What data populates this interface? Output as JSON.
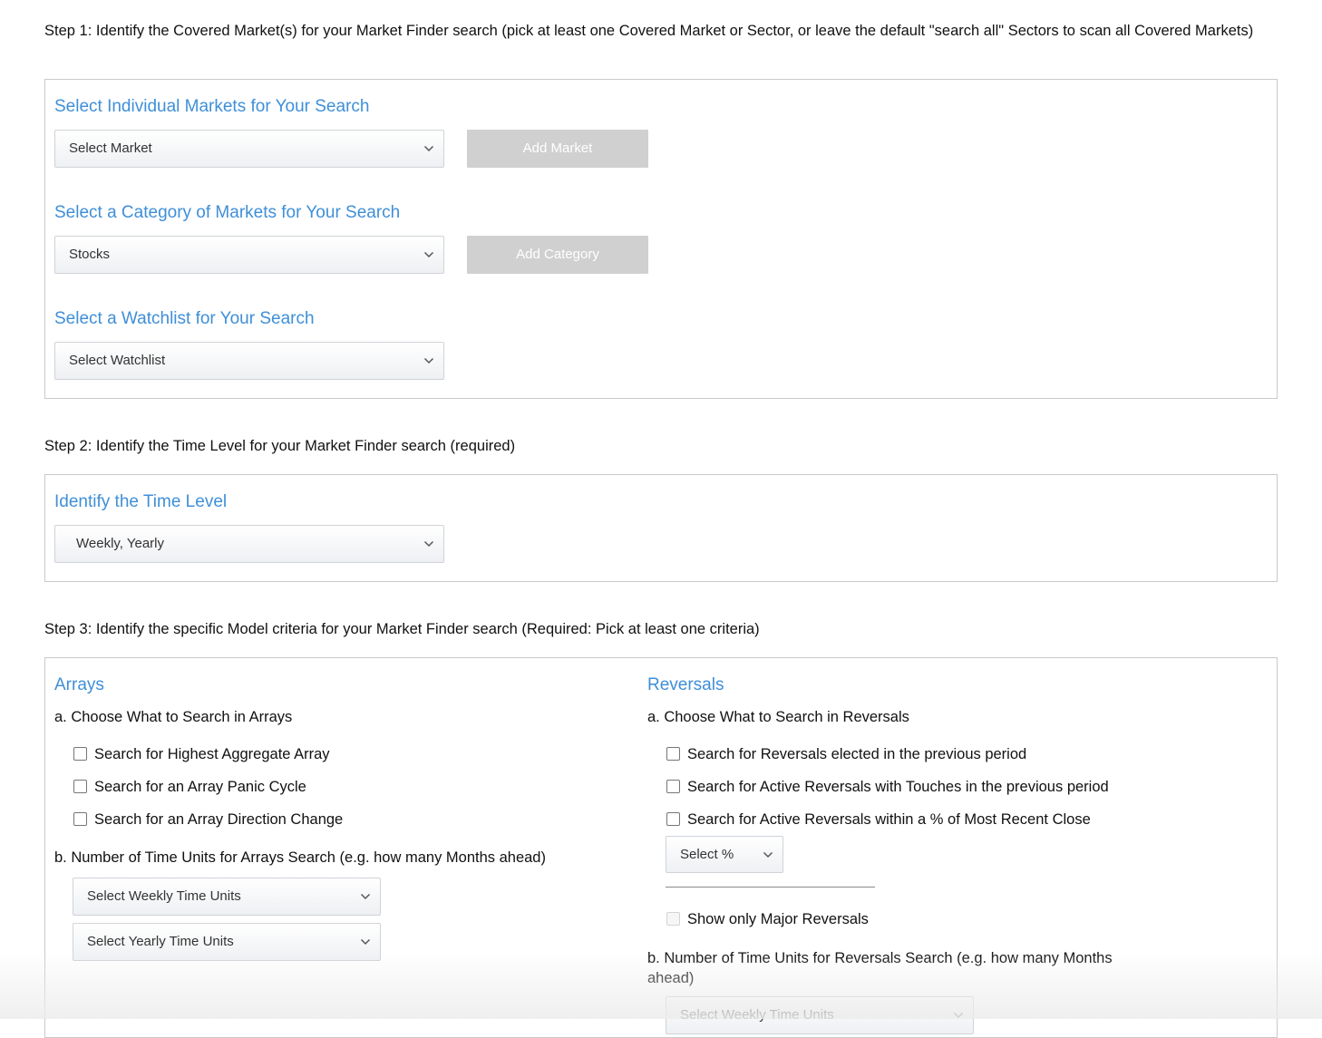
{
  "step1": {
    "label": "Step 1:",
    "text": " Identify the Covered Market(s) for your Market Finder search (pick at least one Covered Market or Sector, or leave the default \"search all\" Sectors to scan all Covered Markets)",
    "market_heading": "Select Individual Markets for Your Search",
    "market_select": "Select Market",
    "add_market_button": "Add Market",
    "category_heading": "Select a Category of Markets for Your Search",
    "category_select": "Stocks",
    "add_category_button": "Add Category",
    "watchlist_heading": "Select a Watchlist for Your Search",
    "watchlist_select": "Select Watchlist"
  },
  "step2": {
    "label": "Step 2:",
    "text": " Identify the Time Level for your Market Finder search (required)",
    "heading": "Identify the Time Level",
    "time_level_select": "Weekly, Yearly"
  },
  "step3": {
    "label": "Step 3:",
    "text": " Identify the specific Model criteria for your Market Finder search (Required: Pick at least one criteria)",
    "arrays": {
      "heading": "Arrays",
      "choose_label": "a.  Choose What to Search in Arrays",
      "options": [
        "Search for Highest Aggregate Array",
        "Search for an Array Panic Cycle",
        "Search for an Array Direction Change"
      ],
      "time_units_label": "b.  Number of Time Units for Arrays Search (e.g. how many Months ahead)",
      "weekly_select": "Select Weekly Time Units",
      "yearly_select": "Select Yearly Time Units"
    },
    "reversals": {
      "heading": "Reversals",
      "choose_label": "a.  Choose What to Search in Reversals",
      "options": [
        "Search for Reversals elected in the previous period",
        "Search for Active Reversals with Touches in the previous period",
        "Search for Active Reversals within a % of Most Recent Close"
      ],
      "percent_select": "Select %",
      "major_only": "Show only Major Reversals",
      "time_units_label": "b.  Number of Time Units for Reversals Search (e.g. how many Months ahead)",
      "weekly_select": "Select Weekly Time Units"
    }
  }
}
